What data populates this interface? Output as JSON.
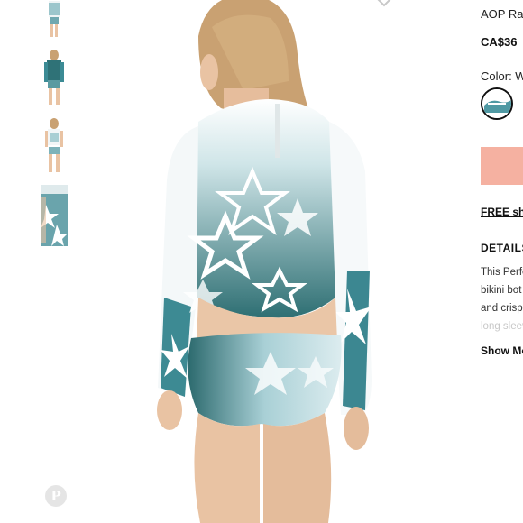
{
  "product": {
    "title": "AOP Ras",
    "price": "CA$36",
    "color_label": "Color: W"
  },
  "buttons": {
    "add_to_bag": ""
  },
  "shipping": {
    "label": "FREE shi"
  },
  "details": {
    "heading": "DETAILS",
    "lines": [
      "This Perfe",
      "bikini bot",
      "and crisp"
    ],
    "faded_line": "long sleev",
    "show_more": "Show Mo"
  },
  "pin_glyph": "P",
  "colors": {
    "accent": "#f5b1a1",
    "teal_dark": "#1f5a5c",
    "teal": "#3c8b95",
    "skin": "#e9c3a3",
    "hair": "#c9a172"
  },
  "icons": [
    "chevron-down-icon",
    "pinterest-icon"
  ]
}
